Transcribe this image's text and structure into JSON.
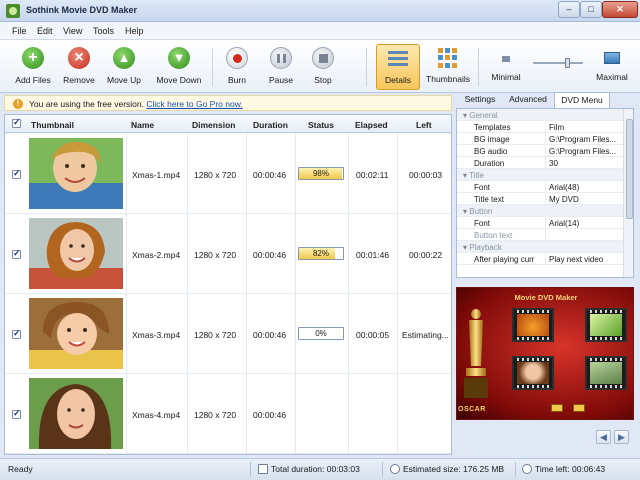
{
  "window": {
    "title": "Sothink Movie DVD Maker"
  },
  "menu": [
    "File",
    "Edit",
    "View",
    "Tools",
    "Help"
  ],
  "toolbar": {
    "add_files": "Add Files",
    "remove": "Remove",
    "move_up": "Move Up",
    "move_down": "Move Down",
    "burn": "Burn",
    "pause": "Pause",
    "stop": "Stop",
    "details": "Details",
    "thumbnails": "Thumbnails",
    "minimal": "Minimal",
    "maximal": "Maximal",
    "zoom_level": 0.7
  },
  "notice": {
    "text": "You are using the free version.",
    "link": "Click here to Go Pro now."
  },
  "table": {
    "headers": {
      "thumbnail": "Thumbnail",
      "name": "Name",
      "dimension": "Dimension",
      "duration": "Duration",
      "status": "Status",
      "elapsed": "Elapsed",
      "left": "Left"
    },
    "rows": [
      {
        "name": "Xmas-1.mp4",
        "dimension": "1280 x 720",
        "duration": "00:00:46",
        "status": "98%",
        "progress": 0.98,
        "elapsed": "00:02:11",
        "left": "00:00:03"
      },
      {
        "name": "Xmas-2.mp4",
        "dimension": "1280 x 720",
        "duration": "00:00:46",
        "status": "82%",
        "progress": 0.82,
        "elapsed": "00:01:46",
        "left": "00:00:22"
      },
      {
        "name": "Xmas-3.mp4",
        "dimension": "1280 x 720",
        "duration": "00:00:46",
        "status": "0%",
        "progress": 0.0,
        "elapsed": "00:00:05",
        "left": "Estimating..."
      },
      {
        "name": "Xmas-4.mp4",
        "dimension": "1280 x 720",
        "duration": "00:00:46",
        "status": "",
        "progress": null,
        "elapsed": "",
        "left": ""
      }
    ]
  },
  "right_tabs": [
    "Settings",
    "Advanced",
    "DVD Menu"
  ],
  "properties": [
    {
      "cat": "General"
    },
    {
      "key": "Templates",
      "value": "Film"
    },
    {
      "key": "BG image",
      "value": "G:\\Program Files..."
    },
    {
      "key": "BG audio",
      "value": "G:\\Program Files..."
    },
    {
      "key": "Duration",
      "value": "30"
    },
    {
      "cat": "Title"
    },
    {
      "key": "Font",
      "value": "Arial(48)"
    },
    {
      "key": "Title text",
      "value": "My DVD"
    },
    {
      "cat": "Button"
    },
    {
      "key": "Font",
      "value": "Arial(14)"
    },
    {
      "key": "Button text",
      "value": ""
    },
    {
      "cat": "Playback"
    },
    {
      "key": "After playing curr",
      "value": "Play next video"
    }
  ],
  "preview": {
    "title": "Movie DVD Maker",
    "oscar": "OSCAR"
  },
  "status": {
    "ready": "Ready",
    "total_duration": "Total duration: 00:03:03",
    "estimated_size": "Estimated size: 176.25 MB",
    "time_left": "Time left: 00:06:43"
  },
  "colors": {
    "accent": "#f7c65a",
    "link": "#1a4fb8",
    "progress": "#f0c94a"
  }
}
